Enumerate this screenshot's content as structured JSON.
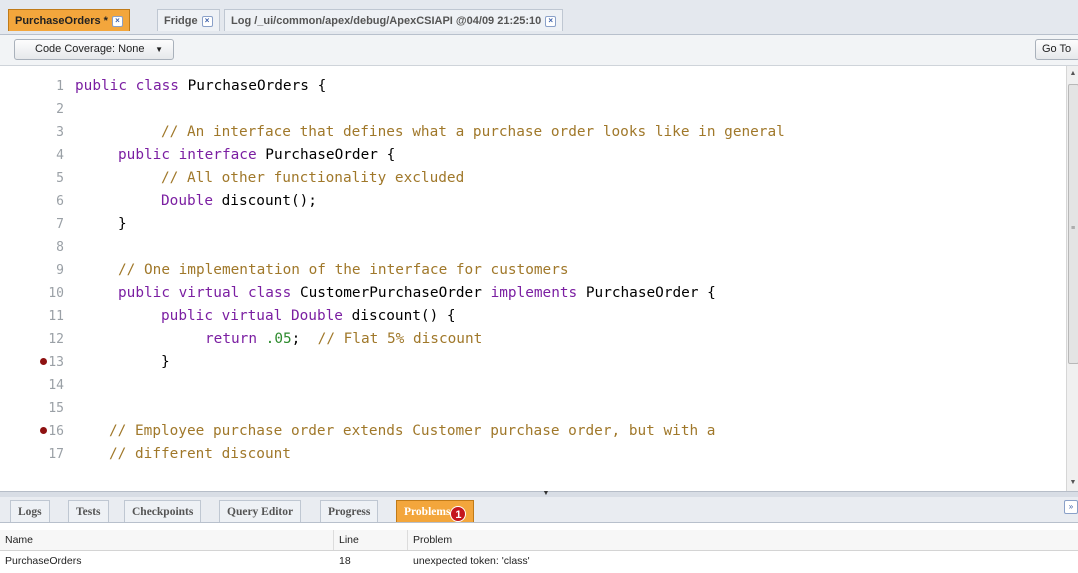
{
  "file_tabs": [
    {
      "label": "PurchaseOrders *",
      "active": true
    },
    {
      "label": "Fridge",
      "active": false
    },
    {
      "label": "Log /_ui/common/apex/debug/ApexCSIAPI @04/09 21:25:10",
      "active": false
    }
  ],
  "toolbar": {
    "coverage_label": "Code Coverage: None",
    "goto_label": "Go To"
  },
  "code_lines": [
    {
      "n": "1",
      "bp": false
    },
    {
      "n": "2",
      "bp": false
    },
    {
      "n": "3",
      "bp": false
    },
    {
      "n": "4",
      "bp": false
    },
    {
      "n": "5",
      "bp": false
    },
    {
      "n": "6",
      "bp": false
    },
    {
      "n": "7",
      "bp": false
    },
    {
      "n": "8",
      "bp": false
    },
    {
      "n": "9",
      "bp": false
    },
    {
      "n": "10",
      "bp": false
    },
    {
      "n": "11",
      "bp": false
    },
    {
      "n": "12",
      "bp": false
    },
    {
      "n": "13",
      "bp": true
    },
    {
      "n": "14",
      "bp": false
    },
    {
      "n": "15",
      "bp": false
    },
    {
      "n": "16",
      "bp": true
    },
    {
      "n": "17",
      "bp": false
    }
  ],
  "code": {
    "l1": [
      "public class",
      " PurchaseOrders {"
    ],
    "l3": "// An interface that defines what a purchase order looks like in general",
    "l4": [
      "public interface",
      " PurchaseOrder {"
    ],
    "l5": "// All other functionality excluded",
    "l6": [
      "Double",
      " discount();"
    ],
    "l7": "}",
    "l9": "// One implementation of the interface for customers",
    "l10": [
      "public virtual class",
      " CustomerPurchaseOrder ",
      "implements",
      " PurchaseOrder {"
    ],
    "l11": [
      "public virtual Double",
      " discount() {"
    ],
    "l12": [
      "return",
      " ",
      ".05",
      ";  ",
      "// Flat 5% discount"
    ],
    "l13": "}",
    "l16": "// Employee purchase order extends Customer purchase order, but with a",
    "l17": "// different discount"
  },
  "bottom_tabs": [
    {
      "label": "Logs",
      "active": false
    },
    {
      "label": "Tests",
      "active": false
    },
    {
      "label": "Checkpoints",
      "active": false
    },
    {
      "label": "Query Editor",
      "active": false
    },
    {
      "label": "Progress",
      "active": false
    },
    {
      "label": "Problems",
      "active": true,
      "badge": "1"
    }
  ],
  "problems": {
    "headers": {
      "name": "Name",
      "line": "Line",
      "problem": "Problem"
    },
    "rows": [
      {
        "name": "PurchaseOrders",
        "line": "18",
        "problem": "unexpected token: 'class'"
      }
    ]
  },
  "colors": {
    "active_tab": "#f3a63c",
    "keyword": "#7b1fa2",
    "comment": "#a0782a",
    "number": "#2e8b2e",
    "breakpoint": "#8e1111",
    "badge": "#c4161c"
  }
}
